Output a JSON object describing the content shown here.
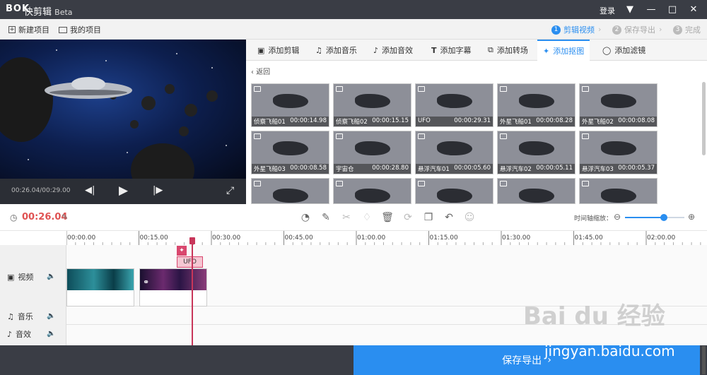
{
  "app": {
    "logo": "BOK",
    "title": "快剪辑",
    "beta": "Beta",
    "login": "登录"
  },
  "menu": {
    "new_project": "新建项目",
    "my_projects": "我的项目"
  },
  "steps": [
    {
      "num": "1",
      "label": "剪辑视频"
    },
    {
      "num": "2",
      "label": "保存导出"
    },
    {
      "num": "3",
      "label": "完成"
    }
  ],
  "player": {
    "time": "00:26.04/00:29.00"
  },
  "tabs": [
    "添加剪辑",
    "添加音乐",
    "添加音效",
    "添加字幕",
    "添加转场",
    "添加抠图",
    "添加滤镜"
  ],
  "back": "返回",
  "assets": [
    {
      "name": "侦察飞船01",
      "duration": "00:00:14.98"
    },
    {
      "name": "侦察飞船02",
      "duration": "00:00:15.15"
    },
    {
      "name": "UFO",
      "duration": "00:00:29.31"
    },
    {
      "name": "外星飞船01",
      "duration": "00:00:08.28"
    },
    {
      "name": "外星飞船02",
      "duration": "00:00:08.08"
    },
    {
      "name": "外星飞船03",
      "duration": "00:00:08.58"
    },
    {
      "name": "宇宙仓",
      "duration": "00:00:28.80"
    },
    {
      "name": "悬浮汽车01",
      "duration": "00:00:05.60"
    },
    {
      "name": "悬浮汽车02",
      "duration": "00:00:05.11"
    },
    {
      "name": "悬浮汽车03",
      "duration": "00:00:05.37"
    },
    {
      "name": "",
      "duration": ""
    },
    {
      "name": "",
      "duration": ""
    },
    {
      "name": "",
      "duration": ""
    },
    {
      "name": "",
      "duration": ""
    },
    {
      "name": "",
      "duration": ""
    }
  ],
  "timeline": {
    "current_time": "00:26.04",
    "zoom_label": "时间轴缩放：",
    "zoom_level": 0.65,
    "ruler": [
      "00:00.00",
      "00:15.00",
      "00:30.00",
      "00:45.00",
      "01:00.00",
      "01:15.00",
      "01:30.00",
      "01:45.00",
      "02:00.00"
    ],
    "ufo_label": "UFO"
  },
  "tracks": {
    "video": "视频",
    "music": "音乐",
    "effects": "音效"
  },
  "save": "保存导出",
  "watermark": {
    "logo": "Bai du 经验",
    "url": "jingyan.baidu.com"
  },
  "colors": {
    "accent": "#2a8ef0",
    "playhead": "#c8365a",
    "titlebar": "#3a3d45"
  }
}
